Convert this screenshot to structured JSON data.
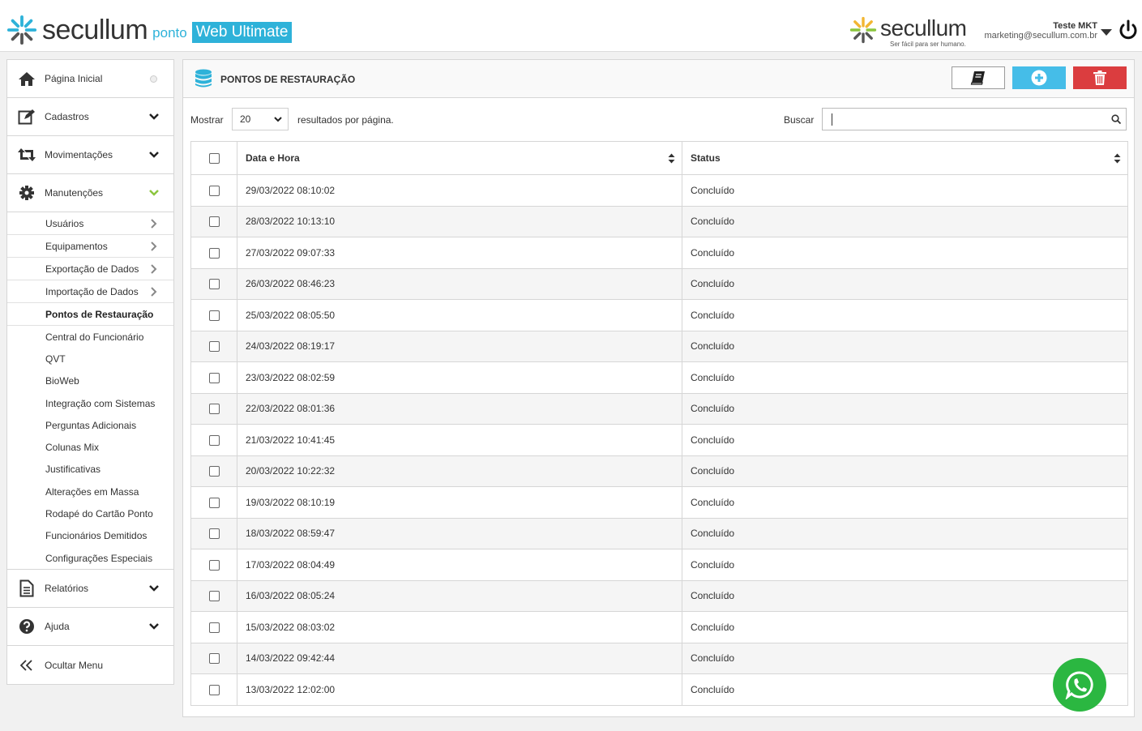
{
  "header": {
    "brand": "secullum",
    "product_small": "ponto",
    "product_badge": "Web Ultimate",
    "right_brand": "secullum",
    "right_tagline": "Ser fácil para ser humano.",
    "user_name": "Teste MKT",
    "user_email": "marketing@secullum.com.br"
  },
  "sidebar": {
    "main_items": [
      {
        "label": "Página Inicial",
        "icon": "home-icon"
      },
      {
        "label": "Cadastros",
        "icon": "edit-icon"
      },
      {
        "label": "Movimentações",
        "icon": "retweet-icon"
      },
      {
        "label": "Manutenções",
        "icon": "cog-icon"
      }
    ],
    "sub_items": [
      "Usuários",
      "Equipamentos",
      "Exportação de Dados",
      "Importação de Dados",
      "Pontos de Restauração",
      "Central do Funcionário",
      "QVT",
      "BioWeb",
      "Integração com Sistemas",
      "Perguntas Adicionais",
      "Colunas Mix",
      "Justificativas",
      "Alterações em Massa",
      "Rodapé do Cartão Ponto",
      "Funcionários Demitidos",
      "Configurações Especiais"
    ],
    "active_sub": "Pontos de Restauração",
    "bottom_items": [
      {
        "label": "Relatórios",
        "icon": "file-icon"
      },
      {
        "label": "Ajuda",
        "icon": "question-icon"
      },
      {
        "label": "Ocultar Menu",
        "icon": "double-chevron-left-icon"
      }
    ],
    "colors": {
      "accent_green": "#8cc63f"
    }
  },
  "panel": {
    "title": "PONTOS DE RESTAURAÇÃO",
    "show_label": "Mostrar",
    "page_size": "20",
    "per_page_label": "resultados por página.",
    "search_label": "Buscar",
    "search_value": "",
    "columns": [
      "Data e Hora",
      "Status"
    ],
    "rows": [
      {
        "datetime": "29/03/2022 08:10:02",
        "status": "Concluído"
      },
      {
        "datetime": "28/03/2022 10:13:10",
        "status": "Concluído"
      },
      {
        "datetime": "27/03/2022 09:07:33",
        "status": "Concluído"
      },
      {
        "datetime": "26/03/2022 08:46:23",
        "status": "Concluído"
      },
      {
        "datetime": "25/03/2022 08:05:50",
        "status": "Concluído"
      },
      {
        "datetime": "24/03/2022 08:19:17",
        "status": "Concluído"
      },
      {
        "datetime": "23/03/2022 08:02:59",
        "status": "Concluído"
      },
      {
        "datetime": "22/03/2022 08:01:36",
        "status": "Concluído"
      },
      {
        "datetime": "21/03/2022 10:41:45",
        "status": "Concluído"
      },
      {
        "datetime": "20/03/2022 10:22:32",
        "status": "Concluído"
      },
      {
        "datetime": "19/03/2022 08:10:19",
        "status": "Concluído"
      },
      {
        "datetime": "18/03/2022 08:59:47",
        "status": "Concluído"
      },
      {
        "datetime": "17/03/2022 08:04:49",
        "status": "Concluído"
      },
      {
        "datetime": "16/03/2022 08:05:24",
        "status": "Concluído"
      },
      {
        "datetime": "15/03/2022 08:03:02",
        "status": "Concluído"
      },
      {
        "datetime": "14/03/2022 09:42:44",
        "status": "Concluído"
      },
      {
        "datetime": "13/03/2022 12:02:00",
        "status": "Concluído"
      }
    ],
    "colors": {
      "add": "#45bde8",
      "delete": "#db3d3f",
      "whatsapp": "#2bb741"
    }
  }
}
